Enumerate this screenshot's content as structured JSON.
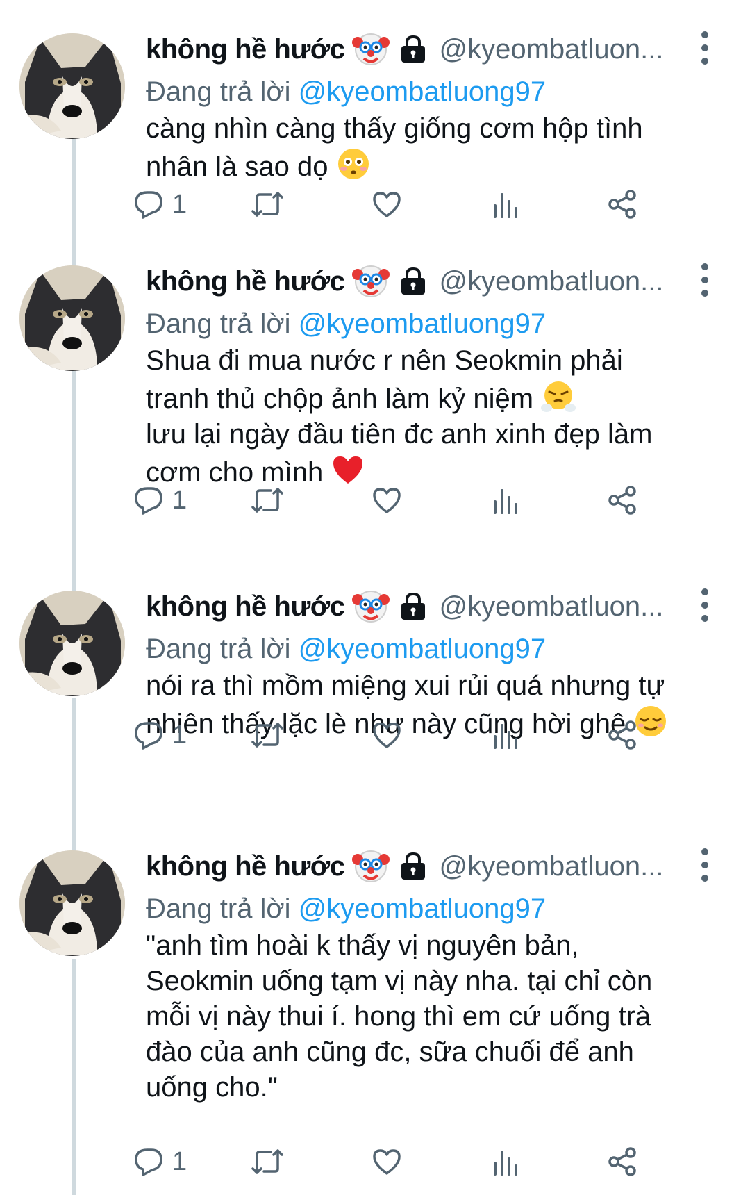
{
  "tweets": [
    {
      "name": "không hề hước",
      "handle": "@kyeombatluon...",
      "replying_prefix": "Đang trả lời",
      "replying_to": "@kyeombatluong97",
      "text_lines": [
        "càng nhìn càng thấy giống cơm hộp tình",
        "nhân là sao dọ"
      ],
      "reply_count": "1"
    },
    {
      "name": "không hề hước",
      "handle": "@kyeombatluon...",
      "replying_prefix": "Đang trả lời",
      "replying_to": "@kyeombatluong97",
      "text_lines": [
        "Shua đi mua nước r nên Seokmin phải",
        "tranh thủ chộp ảnh làm kỷ niệm",
        "lưu lại ngày đầu tiên đc anh xinh đẹp làm",
        "cơm cho mình"
      ],
      "reply_count": "1"
    },
    {
      "name": "không hề hước",
      "handle": "@kyeombatluon...",
      "replying_prefix": "Đang trả lời",
      "replying_to": "@kyeombatluong97",
      "text_lines": [
        "nói ra thì mồm miệng xui rủi quá nhưng tự",
        "nhiên thấy lặc lè như này cũng hời ghê"
      ],
      "reply_count": "1"
    },
    {
      "name": "không hề hước",
      "handle": "@kyeombatluon...",
      "replying_prefix": "Đang trả lời",
      "replying_to": "@kyeombatluong97",
      "text_lines": [
        "\"anh tìm hoài k thấy vị nguyên bản,",
        "Seokmin uống tạm vị này nha. tại chỉ còn",
        "mỗi vị này thui í. hong thì em cứ uống trà",
        "đào của anh cũng đc, sữa chuối để anh",
        "uống cho.\""
      ],
      "reply_count": "1"
    }
  ],
  "icons": {
    "reply": "reply-icon",
    "retweet": "retweet-icon",
    "like": "heart-icon",
    "views": "views-icon",
    "share": "share-icon",
    "menu": "more-vertical-icon"
  },
  "colors": {
    "text": "#0f1419",
    "secondary": "#536471",
    "link": "#1d9bf0",
    "thread_line": "#cfd9de"
  }
}
